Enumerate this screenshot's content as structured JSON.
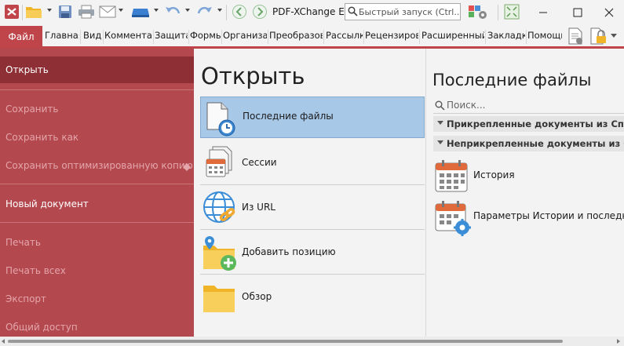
{
  "titlebar": {
    "title": "PDF-XChange E...",
    "quick_launch_placeholder": "Быстрый запуск (Ctrl...",
    "minimize": "—",
    "maximize": "☐",
    "close": "✕"
  },
  "ribbon": {
    "file_tab": "Файл",
    "tabs": [
      "Главная",
      "Вид",
      "Комментарии",
      "Защита",
      "Формы",
      "Организация",
      "Преобразовать",
      "Рассылка",
      "Рецензирование",
      "Расширенный",
      "Закладки",
      "Помощь"
    ]
  },
  "left_menu": {
    "open": "Открыть",
    "save": "Сохранить",
    "save_as": "Сохранить как",
    "save_optimized": "Сохранить оптимизированную копию...",
    "new_document": "Новый документ",
    "print": "Печать",
    "print_all": "Печать всех",
    "export": "Экспорт",
    "share": "Общий доступ"
  },
  "middle": {
    "title": "Открыть",
    "items": [
      {
        "label": "Последние файлы",
        "icon": "recent-files-icon",
        "selected": true
      },
      {
        "label": "Сессии",
        "icon": "sessions-icon",
        "selected": false
      },
      {
        "label": "Из URL",
        "icon": "url-globe-icon",
        "selected": false
      },
      {
        "label": "Добавить позицию",
        "icon": "add-place-icon",
        "selected": false
      },
      {
        "label": "Обзор",
        "icon": "browse-folder-icon",
        "selected": false
      }
    ]
  },
  "right": {
    "title": "Последние файлы",
    "search_placeholder": "Поиск...",
    "pinned_group": "Прикрепленные документы из Списка",
    "unpinned_group": "Неприкрепленные документы из Списка",
    "history": "История",
    "history_settings": "Параметры Истории и последних файлов"
  },
  "colors": {
    "accent": "#c0454b",
    "menu_selected": "#8e2f35",
    "selection_blue": "#a8c8e8"
  }
}
